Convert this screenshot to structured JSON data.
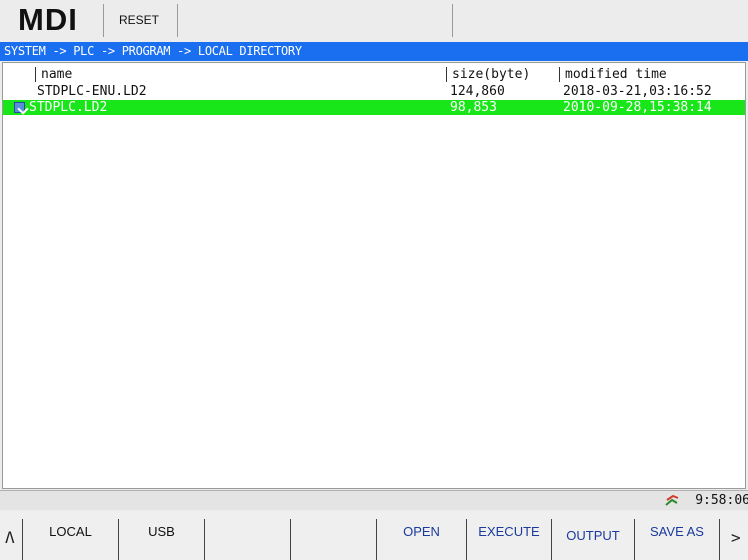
{
  "header": {
    "mode": "MDI",
    "reset": "RESET"
  },
  "breadcrumb": "SYSTEM -> PLC -> PROGRAM -> LOCAL DIRECTORY",
  "file_list": {
    "columns": [
      "name",
      "size(byte)",
      "modified time"
    ],
    "rows": [
      {
        "name": "STDPLC-ENU.LD2",
        "size": "124,860",
        "modified": "2018-03-21,03:16:52",
        "selected": false
      },
      {
        "name": "STDPLC.LD2",
        "size": "98,853",
        "modified": "2010-09-28,15:38:14",
        "selected": true
      }
    ]
  },
  "status": {
    "time": "9:58:06",
    "icon": "network-status-icon"
  },
  "softkeys": {
    "prev": "Λ",
    "next": ">",
    "local": "LOCAL",
    "usb": "USB",
    "open": "OPEN",
    "execute": "EXECUTE",
    "output": "OUTPUT",
    "save_as": "SAVE AS"
  },
  "colors": {
    "path_bar": "#1a6ef0",
    "selected_row": "#19e619",
    "softkey_blue": "#1a3a9c"
  }
}
